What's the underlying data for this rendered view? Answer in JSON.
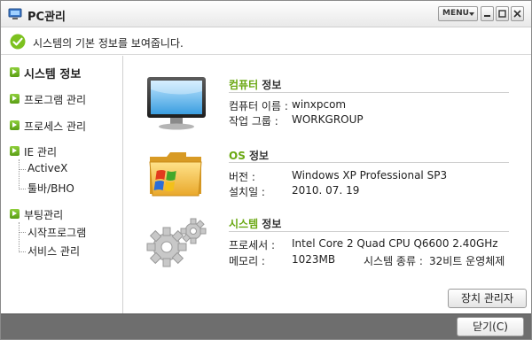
{
  "window": {
    "title": "PC관리",
    "menu_label": "MENU"
  },
  "infobar": {
    "message": "시스템의 기본 정보를 보여줍니다."
  },
  "sidebar": {
    "items": [
      {
        "label": "시스템 정보",
        "active": true
      },
      {
        "label": "프로그램 관리"
      },
      {
        "label": "프로세스 관리"
      },
      {
        "label": "IE 관리",
        "children": [
          "ActiveX",
          "툴바/BHO"
        ]
      },
      {
        "label": "부팅관리",
        "children": [
          "시작프로그램",
          "서비스 관리"
        ]
      }
    ]
  },
  "sections": {
    "computer": {
      "title_accent": "컴퓨터",
      "title_rest": " 정보",
      "rows": [
        {
          "label": "컴퓨터 이름 :",
          "value": "winxpcom"
        },
        {
          "label": "작업 그룹 :",
          "value": "WORKGROUP"
        }
      ]
    },
    "os": {
      "title_accent": "OS",
      "title_rest": " 정보",
      "rows": [
        {
          "label": "버전 :",
          "value": "Windows XP Professional SP3"
        },
        {
          "label": "설치일 :",
          "value": "2010. 07. 19"
        }
      ]
    },
    "system": {
      "title_accent": "시스템",
      "title_rest": " 정보",
      "rows": [
        {
          "label": "프로세서 :",
          "value": "Intel Core 2 Quad CPU Q6600 2.40GHz"
        },
        {
          "label": "메모리 :",
          "value": "1023MB"
        }
      ],
      "system_type_label": "시스템 종류 :",
      "system_type_value": "32비트 운영체제"
    }
  },
  "buttons": {
    "device_manager": "장치 관리자",
    "close": "닫기(C)"
  },
  "colors": {
    "accent": "#6aa812",
    "footer": "#6e6e6e"
  },
  "icons": [
    "pc-app-icon",
    "check-icon",
    "monitor-icon",
    "folder-icon",
    "gears-icon"
  ]
}
